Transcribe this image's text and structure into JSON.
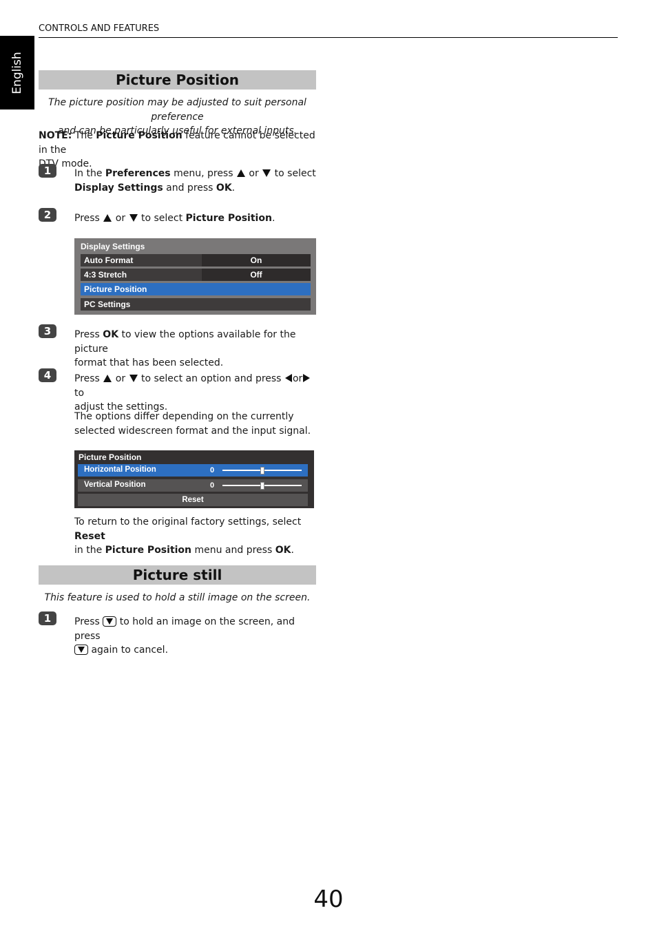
{
  "header": {
    "running_head": "CONTROLS AND FEATURES",
    "language_tab": "English"
  },
  "sections": [
    {
      "title": "Picture Position",
      "intro_line1": "The picture position may be adjusted to suit personal preference",
      "intro_line2": "and can be particularly useful for external inputs.",
      "note": {
        "label": "NOTE:",
        "pre": " The ",
        "bold": "Picture Position",
        "post1": " feature cannot be selected in the",
        "post2": "DTV mode."
      },
      "steps": [
        {
          "number": "1",
          "t1": "In the ",
          "b1": "Preferences",
          "t2": " menu, press ",
          "or": " or ",
          "t3": " to select",
          "b2": "Display Settings",
          "t4": " and press ",
          "b3": "OK",
          "t5": "."
        },
        {
          "number": "2",
          "t1": "Press ",
          "or": " or ",
          "t2": " to select ",
          "b1": "Picture Position",
          "t3": "."
        },
        {
          "number": "3",
          "t1": "Press ",
          "b1": "OK",
          "t2": " to view the options available for the picture",
          "t3": "format that has been selected."
        },
        {
          "number": "4",
          "t1": "Press ",
          "or": " or ",
          "t2": " to select an option and press ",
          "or2": "or",
          "t3": " to",
          "t4": "adjust the settings.",
          "extra1": "The options differ depending on the currently",
          "extra2": "selected widescreen format and the input signal."
        }
      ],
      "display_settings_menu": {
        "title": "Display Settings",
        "items": [
          {
            "label": "Auto Format",
            "value": "On",
            "selected": false
          },
          {
            "label": "4:3 Stretch",
            "value": "Off",
            "selected": false
          },
          {
            "label": "Picture Position",
            "value": "",
            "selected": true
          },
          {
            "label": "PC Settings",
            "value": "",
            "selected": false
          }
        ]
      },
      "picture_position_menu": {
        "title": "Picture Position",
        "items": [
          {
            "label": "Horizontal Position",
            "value": "0",
            "slider_fraction": 0.5,
            "selected": true
          },
          {
            "label": "Vertical Position",
            "value": "0",
            "slider_fraction": 0.5,
            "selected": false
          }
        ],
        "reset_label": "Reset"
      },
      "reset_note": {
        "t1": "To return to the original factory settings, select ",
        "b1": "Reset",
        "t2": "in the ",
        "b2": "Picture Position",
        "t3": " menu and press ",
        "b3": "OK",
        "t4": "."
      }
    },
    {
      "title": "Picture still",
      "intro": "This feature is used to hold a still image on the screen.",
      "steps": [
        {
          "number": "1",
          "t1": "Press ",
          "t2": " to hold an image on the screen, and press",
          "t3": " again to cancel."
        }
      ]
    }
  ],
  "icons": {
    "up": "triangle-up-icon",
    "down": "triangle-down-icon",
    "left": "triangle-left-icon",
    "right": "triangle-right-icon",
    "freeze": "freeze-button-icon"
  },
  "colors": {
    "osd_highlight": "#2d6fc1",
    "section_bar": "#c3c3c3"
  },
  "footer": {
    "page_number": "40"
  }
}
